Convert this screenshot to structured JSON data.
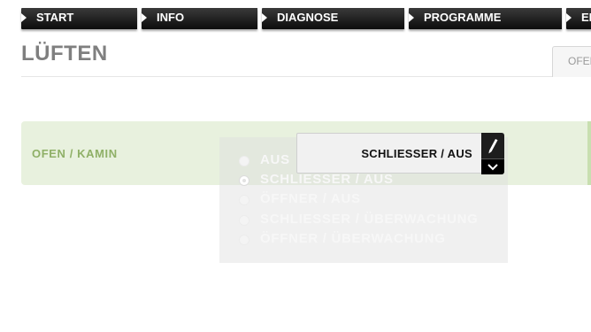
{
  "nav": {
    "items": [
      {
        "label": "START"
      },
      {
        "label": "INFO"
      },
      {
        "label": "DIAGNOSE"
      },
      {
        "label": "PROGRAMME"
      },
      {
        "label": "EI"
      }
    ]
  },
  "page": {
    "title": "LÜFTEN",
    "tab_label": "OFEN"
  },
  "setting": {
    "label": "OFEN / KAMIN",
    "current_value": "SCHLIESSER / AUS",
    "options": [
      {
        "label": "AUS",
        "selected": false
      },
      {
        "label": "SCHLIESSER / AUS",
        "selected": true
      },
      {
        "label": "ÖFFNER / AUS",
        "selected": false
      },
      {
        "label": "SCHLIESSER / ÜBERWACHUNG",
        "selected": false
      },
      {
        "label": "ÖFFNER / ÜBERWACHUNG",
        "selected": false
      }
    ]
  },
  "icons": {
    "edit": "pencil-icon",
    "toggle": "chevron-down-icon",
    "nav": "play-arrow-icon"
  },
  "colors": {
    "nav_bg": "#1a1a1a",
    "row_bg": "#e8f1de",
    "label_green": "#8fb067"
  }
}
